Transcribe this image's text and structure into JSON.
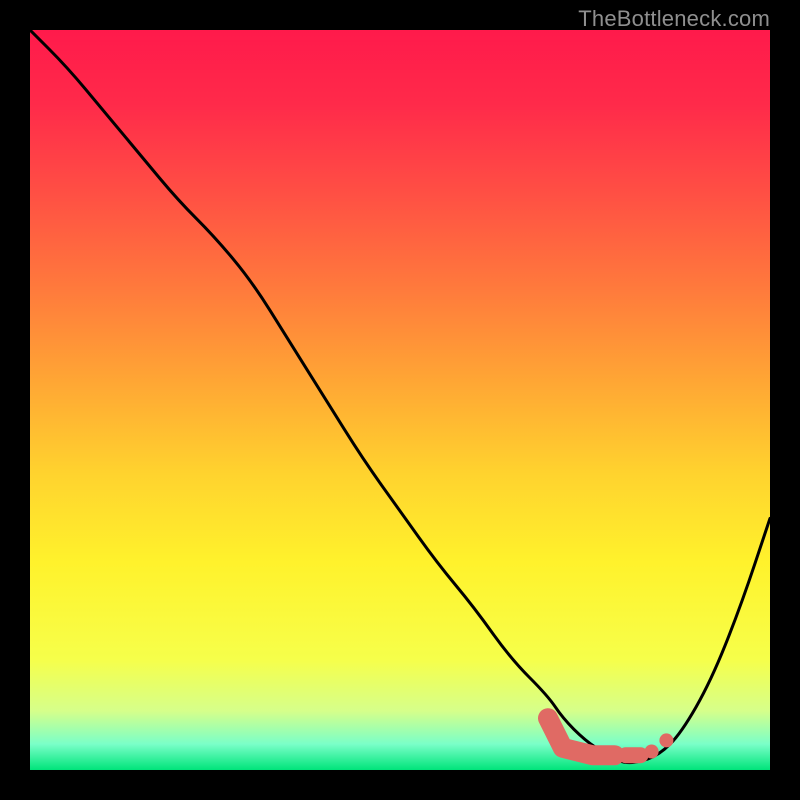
{
  "watermark": "TheBottleneck.com",
  "colors": {
    "frame": "#000000",
    "gradient_stops": [
      {
        "offset": 0.0,
        "color": "#ff1a4b"
      },
      {
        "offset": 0.1,
        "color": "#ff2a4a"
      },
      {
        "offset": 0.22,
        "color": "#ff4f44"
      },
      {
        "offset": 0.35,
        "color": "#ff7a3c"
      },
      {
        "offset": 0.48,
        "color": "#ffa834"
      },
      {
        "offset": 0.6,
        "color": "#ffd32e"
      },
      {
        "offset": 0.72,
        "color": "#fff22c"
      },
      {
        "offset": 0.85,
        "color": "#f6ff4a"
      },
      {
        "offset": 0.92,
        "color": "#d6ff8a"
      },
      {
        "offset": 0.965,
        "color": "#7affc8"
      },
      {
        "offset": 1.0,
        "color": "#00e47a"
      }
    ],
    "curve": "#000000",
    "marker_fill": "#e06a64",
    "marker_stroke": "#b84f49"
  },
  "chart_data": {
    "type": "line",
    "title": "",
    "xlabel": "",
    "ylabel": "",
    "xlim": [
      0,
      100
    ],
    "ylim": [
      0,
      100
    ],
    "grid": false,
    "legend": false,
    "series": [
      {
        "name": "bottleneck-curve",
        "x": [
          0,
          5,
          10,
          15,
          20,
          25,
          30,
          35,
          40,
          45,
          50,
          55,
          60,
          65,
          70,
          72,
          75,
          78,
          80,
          82,
          85,
          88,
          92,
          96,
          100
        ],
        "y": [
          100,
          95,
          89,
          83,
          77,
          72,
          66,
          58,
          50,
          42,
          35,
          28,
          22,
          15,
          10,
          7,
          4,
          2,
          1,
          1,
          2,
          5,
          12,
          22,
          34
        ]
      }
    ],
    "markers": [
      {
        "name": "highlight-segment",
        "shape": "round-cap-segment",
        "points": [
          {
            "x": 70,
            "y": 7
          },
          {
            "x": 72,
            "y": 3
          },
          {
            "x": 76,
            "y": 2
          },
          {
            "x": 79,
            "y": 2
          }
        ]
      },
      {
        "name": "highlight-dash-1",
        "shape": "short-dash",
        "points": [
          {
            "x": 80.5,
            "y": 2
          },
          {
            "x": 82.5,
            "y": 2
          }
        ]
      },
      {
        "name": "highlight-dot-1",
        "shape": "dot",
        "points": [
          {
            "x": 84,
            "y": 2.5
          }
        ]
      },
      {
        "name": "highlight-dot-2",
        "shape": "dot",
        "points": [
          {
            "x": 86,
            "y": 4
          }
        ]
      }
    ]
  }
}
